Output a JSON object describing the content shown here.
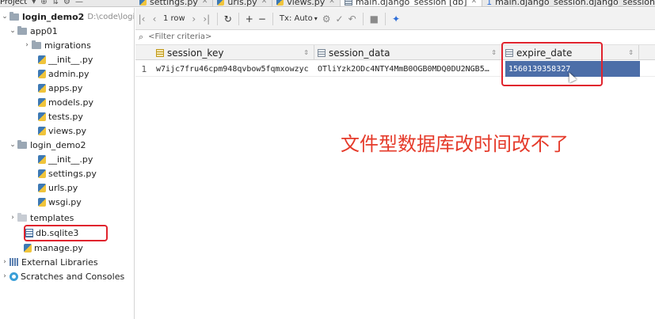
{
  "top_bar": {
    "project_label": "Project",
    "tabs": [
      {
        "label": "settings.py",
        "kind": "python"
      },
      {
        "label": "urls.py",
        "kind": "python"
      },
      {
        "label": "views.py",
        "kind": "python"
      },
      {
        "label": "main.django_session [db]",
        "kind": "table",
        "active": true
      },
      {
        "label": "main.django_session.django_session_expir",
        "kind": "table",
        "number": "1"
      }
    ]
  },
  "tree": {
    "root": {
      "name": "login_demo2",
      "path": "D:\\code\\login"
    },
    "items": [
      {
        "label": "app01",
        "type": "folder"
      },
      {
        "label": "migrations",
        "type": "folder"
      },
      {
        "label": "__init__.py",
        "type": "python"
      },
      {
        "label": "admin.py",
        "type": "python"
      },
      {
        "label": "apps.py",
        "type": "python"
      },
      {
        "label": "models.py",
        "type": "python"
      },
      {
        "label": "tests.py",
        "type": "python"
      },
      {
        "label": "views.py",
        "type": "python"
      },
      {
        "label": "login_demo2",
        "type": "folder"
      },
      {
        "label": "__init__.py",
        "type": "python"
      },
      {
        "label": "settings.py",
        "type": "python"
      },
      {
        "label": "urls.py",
        "type": "python"
      },
      {
        "label": "wsgi.py",
        "type": "python"
      },
      {
        "label": "templates",
        "type": "folder"
      },
      {
        "label": "db.sqlite3",
        "type": "database"
      },
      {
        "label": "manage.py",
        "type": "python"
      },
      {
        "label": "External Libraries",
        "type": "library"
      },
      {
        "label": "Scratches and Consoles",
        "type": "scratch"
      }
    ]
  },
  "toolbar": {
    "row_count": "1 row",
    "tx_mode": "Tx: Auto"
  },
  "filter": {
    "placeholder": "<Filter criteria>"
  },
  "grid": {
    "columns": [
      "session_key",
      "session_data",
      "expire_date"
    ],
    "rows": [
      {
        "num": "1",
        "session_key": "w7ijc7fru46cpm948qvbow5fqmxowzyc",
        "session_data": "OTliYzk2ODc4NTY4MmB0OGB0MDQ0DU2NGB5…",
        "expire_date": "1560139358327"
      }
    ]
  },
  "annotation": "文件型数据库改时间改不了",
  "colors": {
    "highlight_border": "#e0232d",
    "annotation_text": "#e53a2a",
    "selected_cell": "#4c6ea8"
  }
}
